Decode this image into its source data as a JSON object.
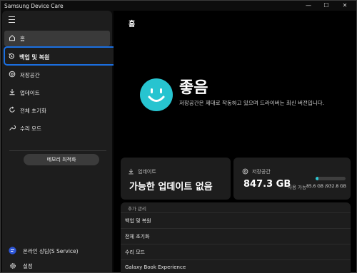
{
  "window": {
    "title": "Samsung Device Care",
    "minimize_glyph": "—",
    "maximize_glyph": "☐",
    "close_glyph": "✕"
  },
  "sidebar": {
    "menu_icon": "hamburger-menu-icon",
    "items": [
      {
        "label": "홈",
        "icon": "home-icon",
        "state": "selected"
      },
      {
        "label": "백업 및 복원",
        "icon": "backup-restore-icon",
        "state": "focused"
      },
      {
        "label": "저장공간",
        "icon": "storage-icon"
      },
      {
        "label": "업데이트",
        "icon": "download-icon"
      },
      {
        "label": "전체 초기화",
        "icon": "reset-icon"
      },
      {
        "label": "수리 모드",
        "icon": "wrench-icon"
      }
    ],
    "memory_button": "메모리 최적화",
    "bottom_items": [
      {
        "label": "온라인 상담(S Service)",
        "icon": "chat-icon"
      },
      {
        "label": "설정",
        "icon": "gear-icon"
      }
    ]
  },
  "main": {
    "title": "홈",
    "status": {
      "word": "좋음",
      "description": "저장공간은 제대로 작동하고 있으며 드라이버는 최신 버전입니다.",
      "icon": "smiley-face-icon",
      "color": "#27c4d0"
    },
    "update_card": {
      "title": "업데이트",
      "value": "가능한 업데이트 없음",
      "icon": "download-icon"
    },
    "storage_card": {
      "title": "저장공간",
      "value": "847.3 GB",
      "used_label": "사용 가능",
      "detail": "85.6 GB /932.8 GB",
      "used_fraction": 0.092,
      "icon": "storage-icon"
    },
    "extra": {
      "header": "추가 관리",
      "rows": [
        "백업 및 복원",
        "전체 초기화",
        "수리 모드",
        "Galaxy Book Experience"
      ]
    }
  }
}
